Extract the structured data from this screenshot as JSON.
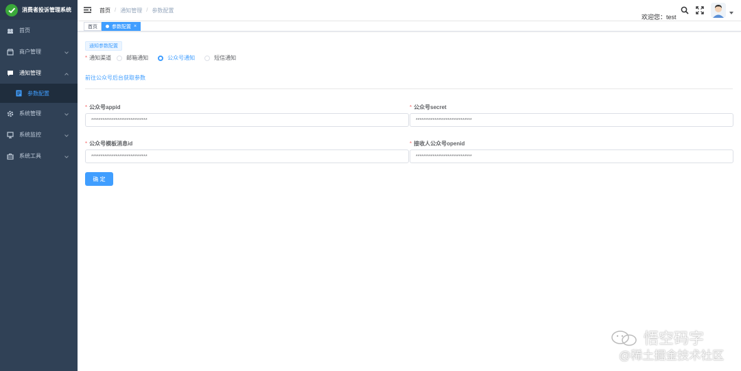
{
  "app": {
    "title": "消费者投诉管理系统",
    "logo_icon": "check-leaf-icon"
  },
  "sidebar": {
    "items": [
      {
        "label": "首页",
        "icon": "dashboard-icon"
      },
      {
        "label": "商户管理",
        "icon": "shop-icon"
      },
      {
        "label": "通知管理",
        "icon": "message-icon"
      },
      {
        "label": "系统管理",
        "icon": "gear-icon"
      },
      {
        "label": "系统监控",
        "icon": "monitor-icon"
      },
      {
        "label": "系统工具",
        "icon": "toolbox-icon"
      }
    ],
    "sub_items": [
      {
        "label": "参数配置",
        "icon": "document-icon"
      }
    ]
  },
  "header": {
    "breadcrumb": [
      "首页",
      "通知管理",
      "参数配置"
    ],
    "welcome": "欢迎您：test"
  },
  "tags": [
    {
      "label": "首页"
    },
    {
      "label": "参数配置"
    }
  ],
  "form": {
    "section_title": "通知参数配置",
    "channel_label": "通知渠道",
    "channels": [
      "邮箱通知",
      "公众号通知",
      "短信通知"
    ],
    "selected_channel": "公众号通知",
    "link_text": "前往公众号后台获取参数",
    "fields": [
      {
        "label": "公众号appid",
        "value": "******************************"
      },
      {
        "label": "公众号secret",
        "value": "******************************"
      },
      {
        "label": "公众号模板消息id",
        "value": "******************************"
      },
      {
        "label": "接收人公众号openid",
        "value": "******************************"
      }
    ],
    "confirm_label": "确 定"
  },
  "watermark": {
    "line1": "悟空码字",
    "line2": "@稀土掘金技术社区"
  },
  "colors": {
    "sidebar_bg": "#304156",
    "accent": "#409eff",
    "required": "#f56c6c"
  }
}
